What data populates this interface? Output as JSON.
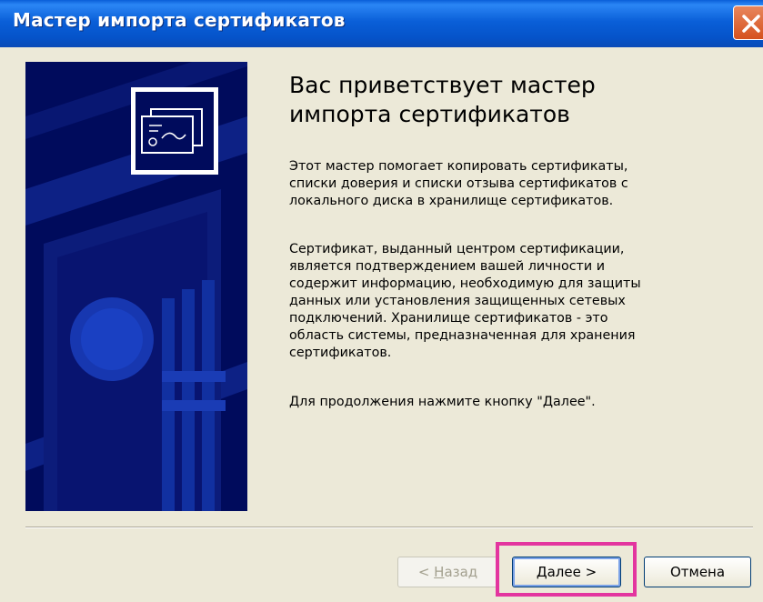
{
  "window": {
    "title": "Мастер импорта сертификатов",
    "close_icon": "close-icon"
  },
  "header": {
    "title_line1": "Вас приветствует мастер",
    "title_line2": "импорта сертификатов"
  },
  "body": {
    "para1": [
      "Этот мастер помогает копировать сертификаты,",
      "списки доверия и списки отзыва сертификатов с",
      "локального диска в хранилище сертификатов."
    ],
    "para2": [
      "Сертификат, выданный центром сертификации,",
      "является подтверждением вашей личности и",
      "содержит информацию, необходимую для защиты",
      "данных или установления защищенных сетевых",
      "подключений. Хранилище сертификатов - это",
      "область системы, предназначенная для хранения",
      "сертификатов."
    ],
    "para3": "Для продолжения нажмите кнопку \"Далее\"."
  },
  "buttons": {
    "back_prefix": "< ",
    "back_hotkey": "Н",
    "back_rest": "азад",
    "next_hotkey": "Д",
    "next_rest": "алее >",
    "cancel": "Отмена"
  },
  "colors": {
    "titlebar": "#0a5fd8",
    "panel": "#000b5c",
    "highlight": "#e3359f"
  }
}
